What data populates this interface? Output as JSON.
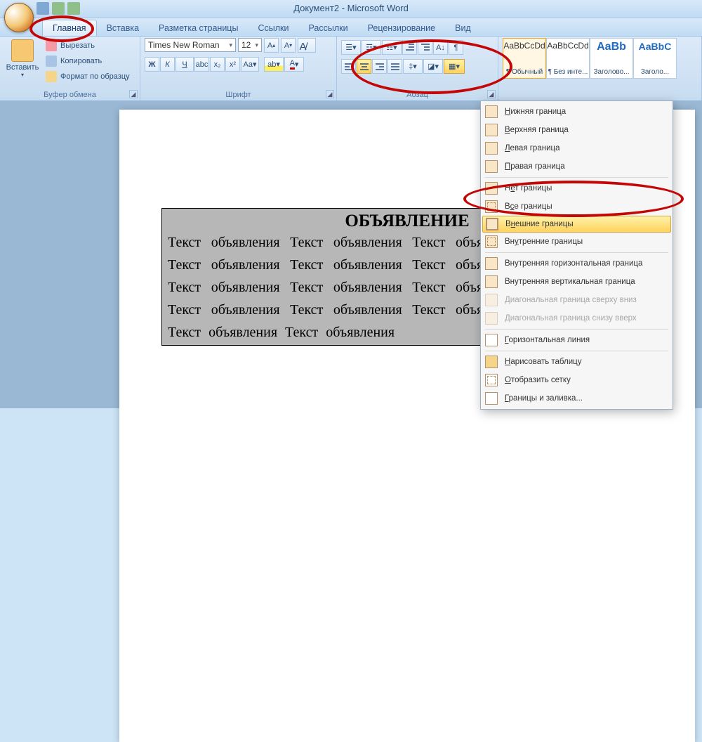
{
  "title": "Документ2 - Microsoft Word",
  "tabs": {
    "home": "Главная",
    "insert": "Вставка",
    "layout": "Разметка страницы",
    "refs": "Ссылки",
    "mail": "Рассылки",
    "review": "Рецензирование",
    "view": "Вид"
  },
  "clipboard": {
    "paste": "Вставить",
    "cut": "Вырезать",
    "copy": "Копировать",
    "format": "Формат по образцу",
    "group": "Буфер обмена"
  },
  "font": {
    "name": "Times New Roman",
    "size": "12",
    "group": "Шрифт",
    "bold": "Ж",
    "italic": "К",
    "underline": "Ч"
  },
  "para": {
    "group": "Абзац"
  },
  "styles": [
    {
      "preview": "AaBbCcDd",
      "name": "¶ Обычный"
    },
    {
      "preview": "AaBbCcDd",
      "name": "¶ Без инте..."
    },
    {
      "preview": "AaBb",
      "name": "Заголово..."
    },
    {
      "preview": "AaBbC",
      "name": "Заголо..."
    }
  ],
  "doc": {
    "title": "ОБЪЯВЛЕНИЕ",
    "body": "Текст объявления  Текст объявления  Текст объявления  Текст объявления  Текст объявления  Текст объявления  Текст объявления  Текст объявления  Текст объявления  Текст объявления  Текст объявления  Текст объявления  Текст объявления  Текст объявления  Текст объявления  Текст объявления  Текст объявления  Текст объявления"
  },
  "menu": {
    "bottom": "Нижняя граница",
    "top": "Верхняя граница",
    "left": "Левая граница",
    "right": "Правая граница",
    "none": "Нет границы",
    "all": "Все границы",
    "outside": "Внешние границы",
    "inside": "Внутренние границы",
    "ih": "Внутренняя горизонтальная граница",
    "iv": "Внутренняя вертикальная граница",
    "diag1": "Диагональная граница сверху вниз",
    "diag2": "Диагональная граница снизу вверх",
    "hline": "Горизонтальная линия",
    "draw": "Нарисовать таблицу",
    "grid": "Отобразить сетку",
    "more": "Границы и заливка..."
  }
}
